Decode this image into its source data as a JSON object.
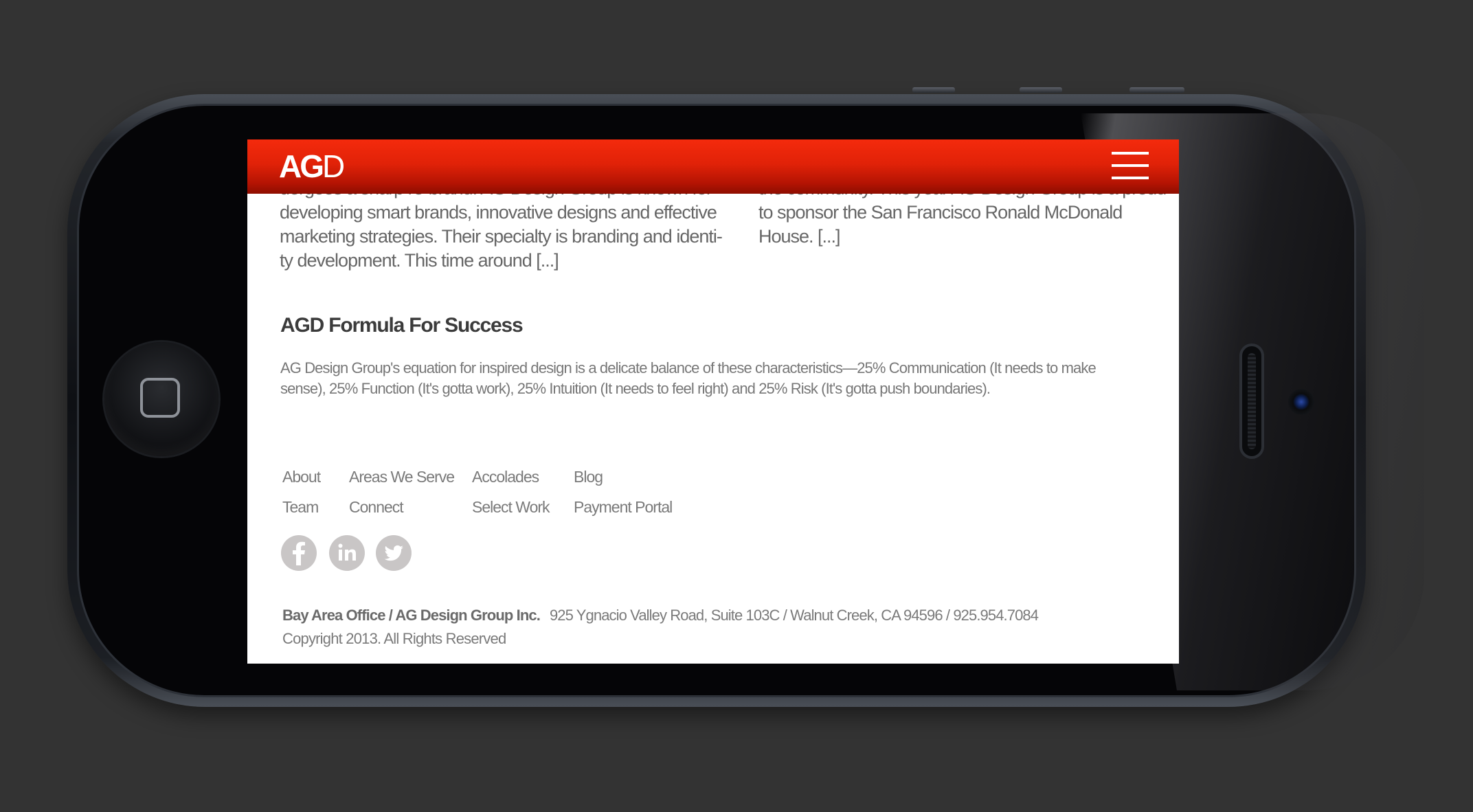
{
  "header": {
    "logo_bold": "AG",
    "logo_light": "D",
    "menu_icon": "hamburger-menu-icon"
  },
  "teasers": {
    "left_lines": [
      "dergoes a sharp re-brand. AG Design Group is known for",
      "developing smart brands, innovative designs and effective",
      "marketing strategies. Their specialty is branding and identi-",
      "ty development. This time around [...]"
    ],
    "right_lines": [
      "the community. This year AG Design Group is a proud",
      "to sponsor the San Francisco Ronald McDonald",
      "House. [...]"
    ]
  },
  "formula": {
    "title": "AGD Formula For Success",
    "body_lines": [
      "AG Design Group's equation for inspired design is a delicate balance of these characteristics—25% Communication (It needs to make",
      "sense), 25% Function (It's gotta work), 25% Intuition (It needs to feel right) and 25% Risk (It's gotta push boundaries)."
    ]
  },
  "footer": {
    "nav": {
      "about": "About",
      "areas": "Areas We Serve",
      "accolades": "Accolades",
      "blog": "Blog",
      "team": "Team",
      "connect": "Connect",
      "select_work": "Select Work",
      "payment_portal": "Payment Portal"
    },
    "social": [
      "facebook-icon",
      "linkedin-icon",
      "twitter-icon"
    ],
    "office": "Bay Area Office / AG Design Group Inc.",
    "address": "925 Ygnacio Valley Road, Suite 103C / Walnut Creek, CA 94596 / 925.954.7084",
    "copyright": "Copyright 2013. All Rights Reserved"
  },
  "colors": {
    "brand_red": "#e12208",
    "page_background": "#333333",
    "text_gray": "#6a6a6a"
  }
}
